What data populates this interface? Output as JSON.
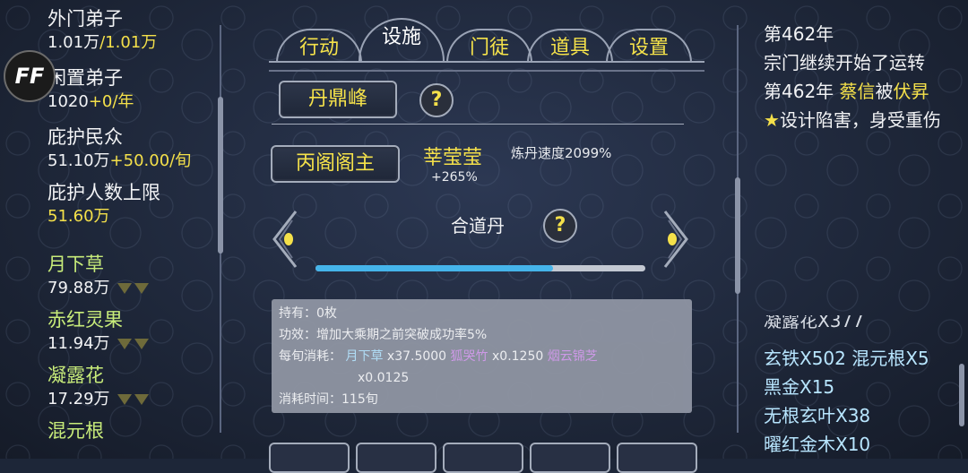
{
  "resources": {
    "outer_disciples": {
      "label": "外门弟子",
      "value": "1.01万",
      "sep": "/",
      "max": "1.01万"
    },
    "idle_disciples": {
      "label": "闲置弟子",
      "value": "1020",
      "delta": "+0/年"
    },
    "protected_people": {
      "label": "庇护民众",
      "value": "51.10万",
      "delta": "+50.00/旬"
    },
    "protect_limit": {
      "label": "庇护人数上限",
      "value": "51.60万"
    },
    "herbs": [
      {
        "name": "月下草",
        "value": "79.88万"
      },
      {
        "name": "赤红灵果",
        "value": "11.94万"
      },
      {
        "name": "凝露花",
        "value": "17.29万"
      },
      {
        "name": "混元根"
      }
    ]
  },
  "logo": {
    "text": "FF"
  },
  "tabs": [
    "行动",
    "设施",
    "门徒",
    "道具",
    "设置"
  ],
  "active_tab": "设施",
  "facility": {
    "peak_button": "丹鼎峰",
    "help_mark": "?",
    "master_button": "丙阁阁主",
    "master_name": "莘莹莹",
    "master_bonus": "+265%",
    "speed_label": "炼丹速度2099%",
    "pill_name": "合道丹",
    "progress_fraction": 0.72
  },
  "details": {
    "hold_label": "持有：",
    "hold_value": "0枚",
    "effect_label": "功效：",
    "effect_value": "增加大乘期之前突破成功率5%",
    "cost_label": "每旬消耗：",
    "costs": [
      {
        "name": "月下草",
        "amount": "x37.5000"
      },
      {
        "name": "狐哭竹",
        "amount": "x0.1250"
      },
      {
        "name": "烟云锦芝",
        "amount": "x0.0125"
      }
    ],
    "time_label": "消耗时间：",
    "time_value": "115旬"
  },
  "log": {
    "line1": "第462年",
    "line2": "宗门继续开始了运转",
    "line3_prefix": "第462年 ",
    "line3_name": "蔡信",
    "line3_mid": "被",
    "line3_name2": "伏昇★",
    "line3_suffix": "设计陷害，身受重伤"
  },
  "inventory": {
    "cut_line": "凝露花X377",
    "line1_a": "玄铁X502 ",
    "line1_b": "混元根X5",
    "line2": "黑金X15",
    "line3": "无根玄叶X38",
    "line4": "曜红金木X10"
  },
  "colors": {
    "accent": "#f4e04a",
    "progress": "#45b4ea",
    "purple": "#d79ff0"
  }
}
